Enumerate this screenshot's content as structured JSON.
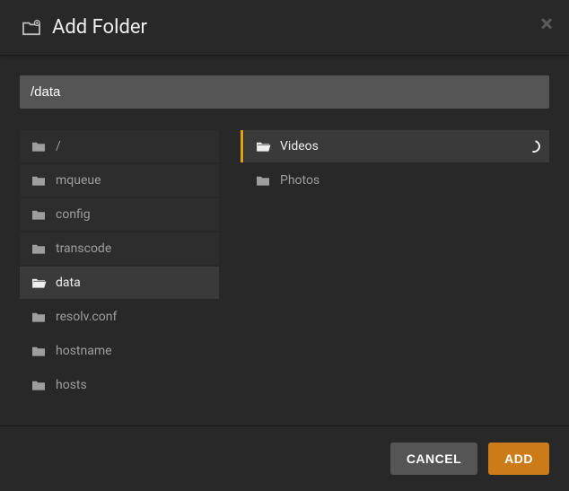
{
  "header": {
    "title": "Add Folder"
  },
  "path": {
    "value": "/data"
  },
  "left_column": [
    {
      "label": "/",
      "selected": false
    },
    {
      "label": "mqueue",
      "selected": false
    },
    {
      "label": "config",
      "selected": false
    },
    {
      "label": "transcode",
      "selected": false
    },
    {
      "label": "data",
      "selected": true
    },
    {
      "label": "resolv.conf",
      "selected": false
    },
    {
      "label": "hostname",
      "selected": false
    },
    {
      "label": "hosts",
      "selected": false
    }
  ],
  "right_column": [
    {
      "label": "Videos",
      "selected": true,
      "loading": true
    },
    {
      "label": "Photos",
      "selected": false,
      "loading": false
    }
  ],
  "footer": {
    "cancel": "CANCEL",
    "add": "ADD"
  },
  "colors": {
    "accent": "#e5a00d",
    "primary_button": "#cc7b19"
  }
}
